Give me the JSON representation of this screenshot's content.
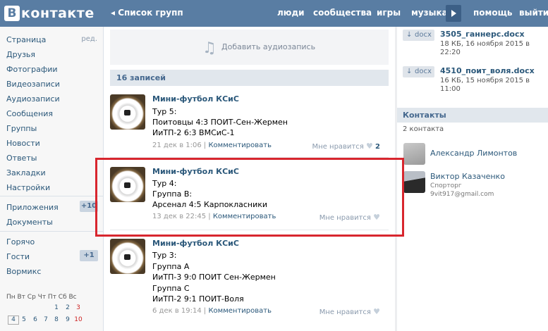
{
  "header": {
    "logo_letter": "В",
    "logo_text": "контакте",
    "back_label": "◂ Список групп",
    "nav": [
      "люди",
      "сообщества",
      "игры",
      "музыка",
      "помощь",
      "выйти"
    ]
  },
  "sidebar": {
    "items": [
      {
        "label": "Страница",
        "extra": "ред."
      },
      {
        "label": "Друзья"
      },
      {
        "label": "Фотографии"
      },
      {
        "label": "Видеозаписи"
      },
      {
        "label": "Аудиозаписи"
      },
      {
        "label": "Сообщения"
      },
      {
        "label": "Группы"
      },
      {
        "label": "Новости"
      },
      {
        "label": "Ответы"
      },
      {
        "label": "Закладки"
      },
      {
        "label": "Настройки"
      },
      {
        "label": "Приложения",
        "badge": "+10"
      },
      {
        "label": "Документы"
      },
      {
        "label": "Горячо"
      },
      {
        "label": "Гости",
        "badge": "+1"
      },
      {
        "label": "Вормикс"
      }
    ],
    "calendar": {
      "weekdays": "Пн Вт Ср Чт Пт Сб Вс",
      "days": [
        "1",
        "2",
        "3",
        "4",
        "5",
        "6",
        "7",
        "8",
        "9",
        "10"
      ]
    }
  },
  "main": {
    "add_audio_label": "Добавить аудиозапись",
    "posts_count": "16 записей",
    "posts": [
      {
        "author": "Мини-футбол КСиС",
        "lines": [
          "Тур 5:",
          "Поитовцы 4:3 ПОИТ-Сен-Жермен",
          "ИиТП-2 6:3 ВМСиС-1"
        ],
        "date": "21 дек в 1:06",
        "comment_label": "Комментировать",
        "like_label": "Мне нравится",
        "like_count": "2"
      },
      {
        "author": "Мини-футбол КСиС",
        "lines": [
          "Тур 4:",
          "Группа В:",
          "Арсенал 4:5 Карпокласники"
        ],
        "date": "13 дек в 22:45",
        "comment_label": "Комментировать",
        "like_label": "Мне нравится",
        "like_count": ""
      },
      {
        "author": "Мини-футбол КСиС",
        "lines": [
          "Тур 3:",
          "Группа А",
          "ИиТП-3 9:0 ПОИТ Сен-Жермен",
          "Группа С",
          "ИиТП-2 9:1 ПОИТ-Воля"
        ],
        "date": "6 дек в 19:14",
        "comment_label": "Комментировать",
        "like_label": "Мне нравится",
        "like_count": ""
      }
    ]
  },
  "right": {
    "docs": [
      {
        "button": "docx",
        "name": "3505_ганнерс.docx",
        "info1": "18 КБ, 16 ноября 2015 в",
        "info2": "22:20"
      },
      {
        "button": "docx",
        "name": "4510_поит_воля.docx",
        "info1": "16 КБ, 15 ноября 2015 в",
        "info2": "11:00"
      }
    ],
    "contacts_title": "Контакты",
    "contacts_count": "2 контакта",
    "contacts": [
      {
        "name": "Александр Лимонтов"
      },
      {
        "name": "Виктор Казаченко",
        "role": "Спорторг",
        "email": "9vit917@gmail.com"
      }
    ]
  },
  "colors": {
    "brand": "#597da3",
    "link": "#2b587a",
    "highlight": "#d8262e"
  }
}
